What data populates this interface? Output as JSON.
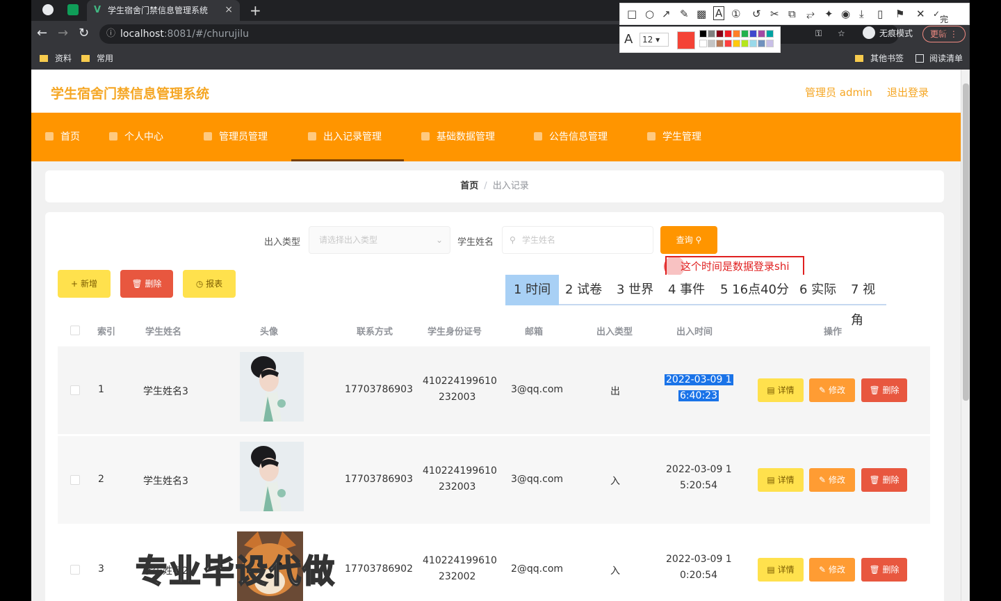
{
  "browser": {
    "tab_title": "学生宿舍门禁信息管理系统",
    "tab_close": "×",
    "new_tab": "+",
    "url_host": "localhost",
    "url_rest": ":8081/#/churujilu",
    "incognito_label": "无痕模式",
    "update_label": "更新",
    "bookmarks": [
      "资料",
      "常用"
    ],
    "bookmarks_right": [
      "其他书签",
      "阅读清单"
    ]
  },
  "annotation_tool": {
    "font_size": "12",
    "done_label": "完成",
    "active_color": "#f44336",
    "swatches": [
      "#000000",
      "#7f7f7f",
      "#880015",
      "#ed1c24",
      "#ff7f27",
      "#22b14c",
      "#3f48cc",
      "#a349a4",
      "#00a2a2",
      "#ffffff",
      "#c3c3c3",
      "#b97a57",
      "#ff4040",
      "#ffc90e",
      "#b5e61d",
      "#99d9ea",
      "#7092be",
      "#c8bfe7"
    ]
  },
  "app": {
    "title": "学生宿舍门禁信息管理系统",
    "user_label": "管理员 admin",
    "logout_label": "退出登录",
    "nav": [
      "首页",
      "个人中心",
      "管理员管理",
      "出入记录管理",
      "基础数据管理",
      "公告信息管理",
      "学生管理"
    ],
    "active_nav": 3
  },
  "breadcrumb": {
    "home": "首页",
    "sep": "/",
    "current": "出入记录"
  },
  "filters": {
    "type_label": "出入类型",
    "type_placeholder": "请选择出入类型",
    "name_label": "学生姓名",
    "name_placeholder": "学生姓名",
    "query_label": "查询"
  },
  "actions": {
    "add": "新增",
    "delete": "删除",
    "report": "报表"
  },
  "annotation": {
    "text": "这个时间是数据登录shi"
  },
  "ime": {
    "candidates": [
      "1 时间",
      "2 试卷",
      "3 世界",
      "4 事件",
      "5 16点40分",
      "6 实际",
      "7 视角"
    ]
  },
  "table": {
    "columns": [
      "索引",
      "学生姓名",
      "头像",
      "联系方式",
      "学生身份证号",
      "邮箱",
      "出入类型",
      "出入时间",
      "操作"
    ],
    "rows": [
      {
        "index": "1",
        "name": "学生姓名3",
        "phone": "17703786903",
        "id1": "410224199610",
        "id2": "232003",
        "email": "3@qq.com",
        "type": "出",
        "time1": "2022-03-09 1",
        "time2": "6:40:23"
      },
      {
        "index": "2",
        "name": "学生姓名3",
        "phone": "17703786903",
        "id1": "410224199610",
        "id2": "232003",
        "email": "3@qq.com",
        "type": "入",
        "time1": "2022-03-09 1",
        "time2": "5:20:54"
      },
      {
        "index": "3",
        "name": "学生姓名2",
        "phone": "17703786902",
        "id1": "410224199610",
        "id2": "232002",
        "email": "2@qq.com",
        "type": "入",
        "time1": "2022-03-09 1",
        "time2": "0:20:54"
      }
    ],
    "row_actions": {
      "detail": "详情",
      "edit": "修改",
      "delete": "删除"
    }
  },
  "watermark": "专业毕设代做"
}
